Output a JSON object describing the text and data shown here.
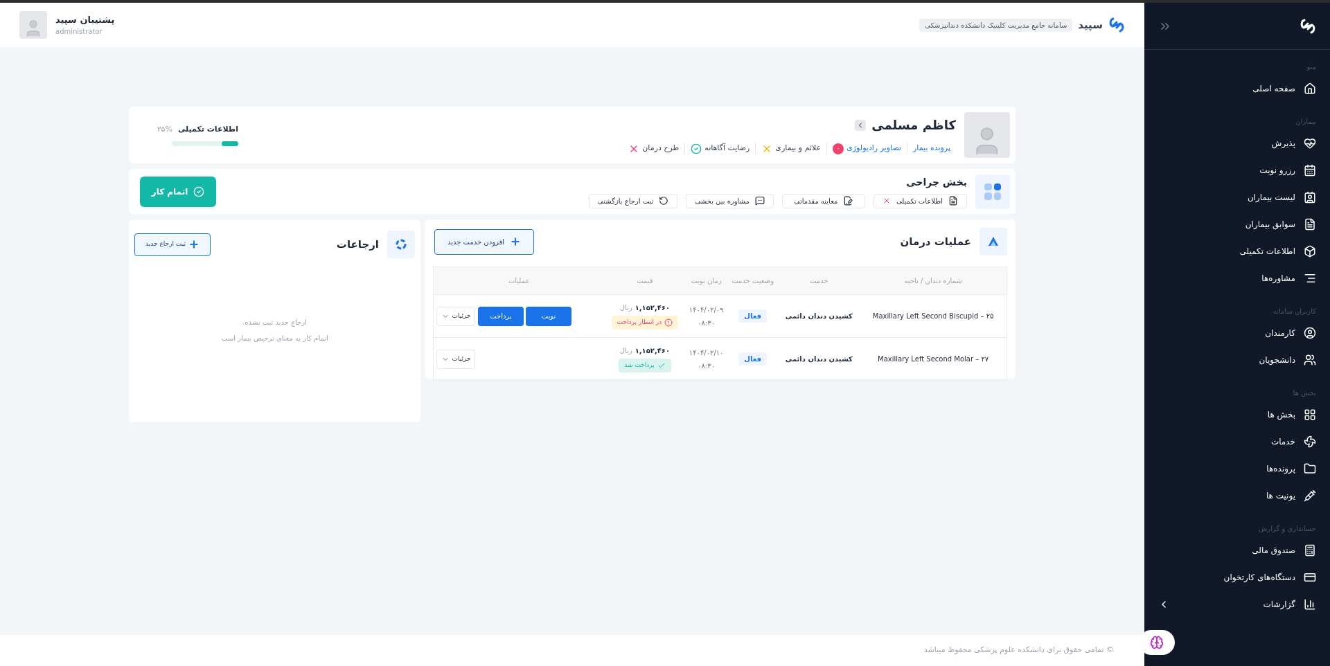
{
  "header": {
    "brand": "سپید",
    "system_badge": "سامانه جامع مدیریت کلینیک دانشکده دندانپزشکی",
    "user_name": "پشتیبان سپید",
    "user_role": "administrator"
  },
  "patient": {
    "name": "کاظم مسلمی",
    "links": [
      {
        "label": "پرونده بیمار",
        "kind": "link"
      },
      {
        "label": "تصاویر رادیولوژی",
        "kind": "count",
        "count": "۰"
      },
      {
        "label": "علائم و بیماری",
        "kind": "warning"
      },
      {
        "label": "رضایت آگاهانه",
        "kind": "done"
      },
      {
        "label": "طرح درمان",
        "kind": "missing"
      }
    ],
    "completion": {
      "label": "اطلاعات تکمیلی",
      "reading": "۲۵%",
      "level": 0.25
    }
  },
  "section": {
    "title": "بخش جراحی",
    "actions": [
      {
        "label": "اطلاعات تکمیلی",
        "missing": true
      },
      {
        "label": "معاینه مقدماتی",
        "missing": false
      },
      {
        "label": "مشاوره بین بخشی",
        "missing": false
      },
      {
        "label": "ثبت ارجاع بازگشتی",
        "missing": false
      }
    ],
    "finish_button": "اتمام کار"
  },
  "treatment": {
    "title": "عملیات درمان",
    "add_button": "افزودن خدمت جدید",
    "table": {
      "columns": [
        "شماره دندان / ناحیه",
        "خدمت",
        "وضعیت خدمت",
        "زمان نوبت",
        "قیمت",
        "عملیات"
      ],
      "rows": [
        {
          "tooth": "۲۵ – Maxillary Left Second Biscupid",
          "service": "کشیدن دندان دائمی",
          "status": "فعال",
          "date": "۱۴۰۴/۰۲/۰۹",
          "time": "۰۸:۳۰",
          "price": "۱,۱۵۲,۴۶۰",
          "currency": "ریال",
          "payment": {
            "kind": "pending",
            "label": "در انتظار پرداخت"
          },
          "buttons": [
            "نوبت",
            "پرداخت"
          ],
          "details": "جزئیات"
        },
        {
          "tooth": "۲۷ – Maxillary Left Second Molar",
          "service": "کشیدن دندان دائمی",
          "status": "فعال",
          "date": "۱۴۰۴/۰۲/۱۰",
          "time": "۰۸:۳۰",
          "price": "۱,۱۵۲,۴۶۰",
          "currency": "ریال",
          "payment": {
            "kind": "paid",
            "label": "پرداخت شد"
          },
          "details": "جزئیات"
        }
      ]
    }
  },
  "referrals": {
    "title": "ارجاعات",
    "add_button": "ثبت ارجاع جدید",
    "empty_lines": [
      "ارجاع جدید ثبت نشده.",
      "اتمام کار به معنای ترخیص بیمار است"
    ]
  },
  "footer": "© تمامی حقوق برای دانشکده علوم پزشکی محفوظ میباشد",
  "sidebar": {
    "groups": [
      {
        "title": "منو",
        "items": [
          {
            "label": "صفحه اصلی",
            "selected": false
          }
        ]
      },
      {
        "title": "بیماران",
        "items": [
          {
            "label": "پذیرش",
            "selected": false
          },
          {
            "label": "رزرو نوبت",
            "selected": false
          },
          {
            "label": "لیست بیماران",
            "selected": false
          },
          {
            "label": "سوابق بیماران",
            "selected": false
          },
          {
            "label": "اطلاعات تکمیلی",
            "selected": false
          },
          {
            "label": "مشاوره‌ها",
            "selected": false
          }
        ]
      },
      {
        "title": "کاربران سامانه",
        "items": [
          {
            "label": "کارمندان",
            "selected": false
          },
          {
            "label": "دانشجویان",
            "selected": false
          }
        ]
      },
      {
        "title": "بخش ها",
        "items": [
          {
            "label": "بخش ها",
            "selected": false
          },
          {
            "label": "خدمات",
            "selected": false
          },
          {
            "label": "پرونده‌ها",
            "selected": false
          },
          {
            "label": "یونیت ها",
            "selected": false
          }
        ]
      },
      {
        "title": "حسابداری و گزارش",
        "items": [
          {
            "label": "صندوق مالی",
            "selected": false
          },
          {
            "label": "دستگاه‌های کارتخوان",
            "selected": false
          },
          {
            "label": "گزارشات",
            "selected": false,
            "expanded": false
          }
        ]
      }
    ]
  }
}
